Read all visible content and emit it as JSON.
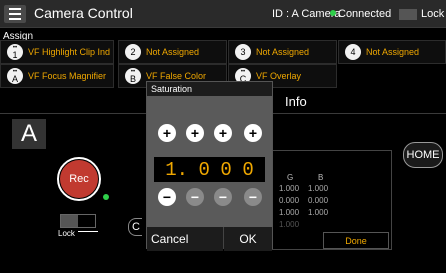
{
  "header": {
    "title": "Camera Control",
    "camera_id": "ID : A Camera",
    "connection": "Connected",
    "lock_label": "Lock"
  },
  "assign": {
    "label": "Assign",
    "row1": [
      {
        "badge": "1",
        "label": "VF Highlight Clip Ind"
      },
      {
        "badge": "2",
        "label": "Not Assigned"
      },
      {
        "badge": "3",
        "label": "Not Assigned"
      },
      {
        "badge": "4",
        "label": "Not Assigned"
      }
    ],
    "row2": [
      {
        "badge": "A",
        "label": "VF Focus Magnifier"
      },
      {
        "badge": "B",
        "label": "VF False Color"
      },
      {
        "badge": "C",
        "label": "VF Overlay"
      }
    ]
  },
  "main": {
    "info_title": "Info",
    "camera_letter": "A",
    "rec_label": "Rec",
    "lock_label": "Lock",
    "c_label": "C",
    "home_label": "HOME",
    "done_label": "Done",
    "table": {
      "col_g": "G",
      "col_b": "B",
      "rows": [
        [
          "1.000",
          "1.000"
        ],
        [
          "0.000",
          "0.000"
        ],
        [
          "1.000",
          "1.000"
        ],
        [
          "1.000",
          ""
        ]
      ]
    }
  },
  "dialog": {
    "title": "Saturation",
    "digits": [
      "1.",
      "0",
      "0",
      "0"
    ],
    "cancel_label": "Cancel",
    "ok_label": "OK"
  },
  "colors": {
    "accent": "#f0a800",
    "rec": "#c13a30",
    "connected": "#2fcf4a"
  }
}
